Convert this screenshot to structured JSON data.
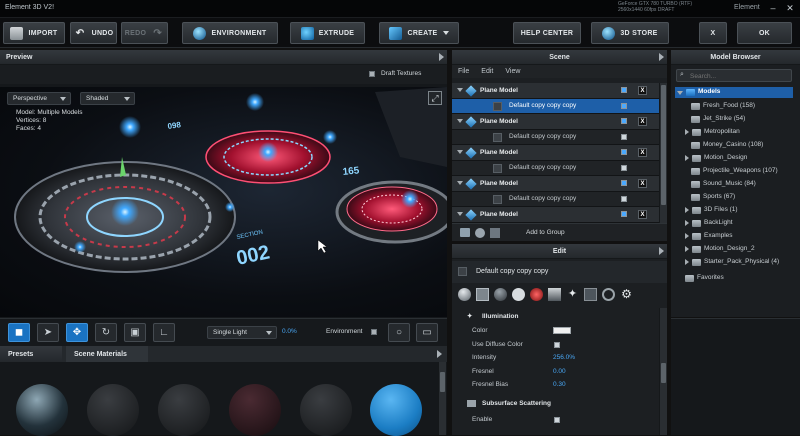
{
  "window": {
    "title": "Element 3D V2!",
    "perf_line1": "GeForce GTX 780 TURBO (RTF)",
    "perf_line2": "2560x1440 60fps DRAFT",
    "brand": "Element",
    "minimize": "–",
    "close": "✕"
  },
  "toolbar": {
    "import": "IMPORT",
    "undo": "UNDO",
    "redo": "REDO",
    "environment": "ENVIRONMENT",
    "extrude": "EXTRUDE",
    "create": "CREATE",
    "help_center": "HELP CENTER",
    "store": "3D STORE",
    "cancel": "X",
    "ok": "OK"
  },
  "preview": {
    "title": "Preview",
    "draft_textures": "Draft Textures",
    "view_mode": "Perspective",
    "shade_mode": "Shaded",
    "model_label": "Model:",
    "model_value": "Multiple Models",
    "vertices_label": "Vertices:",
    "vertices_value": "8",
    "faces_label": "Faces:",
    "faces_value": "4",
    "hud_text_1": "SECTION",
    "hud_text_2": "002",
    "hud_text_3": "165",
    "hud_text_4": "098",
    "lighting": "Single Light",
    "lighting_value": "0.0%",
    "environment_label": "Environment"
  },
  "presets": {
    "tab_presets": "Presets",
    "tab_materials": "Scene Materials"
  },
  "scene": {
    "title": "Scene",
    "menu": [
      "File",
      "Edit",
      "View"
    ],
    "rows": [
      {
        "type": "parent",
        "label": "Plane Model"
      },
      {
        "type": "child",
        "label": "Default copy copy copy",
        "selected": true
      },
      {
        "type": "parent",
        "label": "Plane Model"
      },
      {
        "type": "child",
        "label": "Default copy copy copy"
      },
      {
        "type": "parent",
        "label": "Plane Model"
      },
      {
        "type": "child",
        "label": "Default copy copy copy"
      },
      {
        "type": "parent",
        "label": "Plane Model"
      },
      {
        "type": "child",
        "label": "Default copy copy copy"
      },
      {
        "type": "parent",
        "label": "Plane Model"
      }
    ],
    "add_to_group": "Add to Group"
  },
  "edit": {
    "title": "Edit",
    "material_name": "Default copy copy copy",
    "illumination": "Illumination",
    "color_label": "Color",
    "use_diffuse_label": "Use Diffuse Color",
    "intensity_label": "Intensity",
    "intensity_value": "256.0%",
    "fresnel_label": "Fresnel",
    "fresnel_value": "0.00",
    "fresnel_bias_label": "Fresnel Bias",
    "fresnel_bias_value": "0.30",
    "subsurface": "Subsurface Scattering",
    "enable_label": "Enable"
  },
  "model_browser": {
    "title": "Model Browser",
    "search_placeholder": "Search...",
    "root": "Models",
    "items": [
      "Fresh_Food (158)",
      "Jet_Strike (54)",
      "Metropolitan",
      "Money_Casino (108)",
      "Motion_Design",
      "Projectile_Weapons (107)",
      "Sound_Music (84)",
      "Sports (67)",
      "3D Files (1)",
      "BackLight",
      "Examples",
      "Motion_Design_2",
      "Starter_Pack_Physical (4)"
    ],
    "favorites": "Favorites"
  }
}
